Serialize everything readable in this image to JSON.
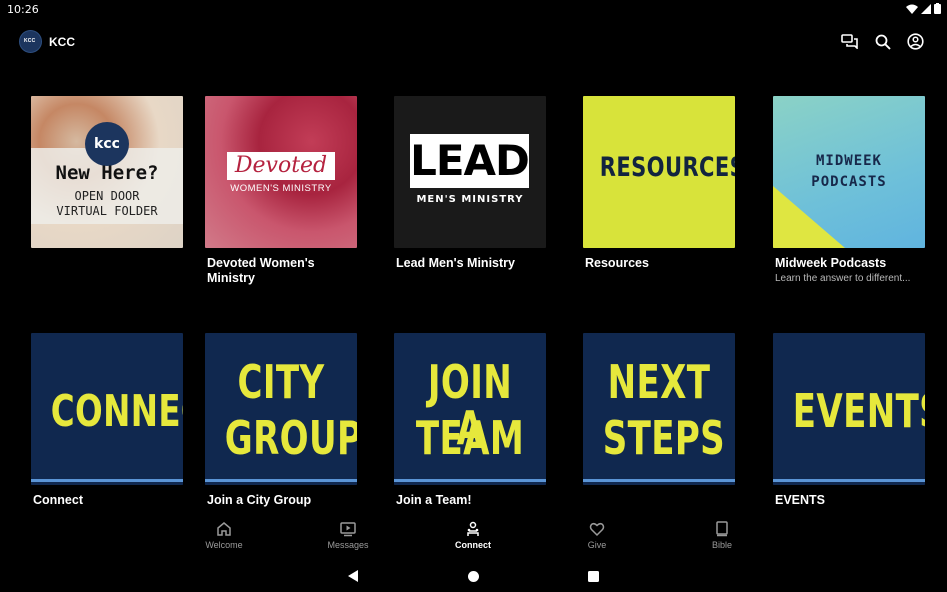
{
  "status": {
    "time": "10:26"
  },
  "app": {
    "logo_text": "KCC",
    "title": "KCC"
  },
  "tiles_row1": [
    {
      "title": "",
      "subtitle": "",
      "art": {
        "badge": "kcc",
        "line1": "New Here?",
        "line2": "OPEN DOOR",
        "line3": "VIRTUAL FOLDER"
      }
    },
    {
      "title": "Devoted Women's Ministry",
      "subtitle": "",
      "art": {
        "line1": "Devoted",
        "line2": "WOMEN'S MINISTRY"
      }
    },
    {
      "title": "Lead Men's Ministry",
      "subtitle": "",
      "art": {
        "line1": "LEAD",
        "line2": "MEN'S MINISTRY"
      }
    },
    {
      "title": "Resources",
      "subtitle": "",
      "art": {
        "line1": "RESOURCES"
      }
    },
    {
      "title": "Midweek Podcasts",
      "subtitle": "Learn the answer to different...",
      "art": {
        "line1": "MIDWEEK",
        "line2": "PODCASTS"
      }
    }
  ],
  "tiles_row2": [
    {
      "title": "Connect",
      "art": {
        "line1": "CONNECT",
        "line2": ""
      }
    },
    {
      "title": "Join a City Group",
      "art": {
        "line1": "CITY",
        "line2": "GROUP"
      }
    },
    {
      "title": "Join a Team!",
      "art": {
        "line1": "JOIN A",
        "line2": "TEAM"
      }
    },
    {
      "title": "",
      "art": {
        "line1": "NEXT",
        "line2": "STEPS"
      }
    },
    {
      "title": "EVENTS",
      "art": {
        "line1": "EVENTS",
        "line2": ""
      }
    }
  ],
  "bottom_nav": [
    {
      "label": "Welcome",
      "icon": "home-icon",
      "active": false
    },
    {
      "label": "Messages",
      "icon": "video-icon",
      "active": false
    },
    {
      "label": "Connect",
      "icon": "people-icon",
      "active": true
    },
    {
      "label": "Give",
      "icon": "heart-icon",
      "active": false
    },
    {
      "label": "Bible",
      "icon": "book-icon",
      "active": false
    }
  ],
  "colors": {
    "navy": "#10284f",
    "yellow": "#e6e83c",
    "lime": "#d8e33a",
    "background": "#000000"
  }
}
